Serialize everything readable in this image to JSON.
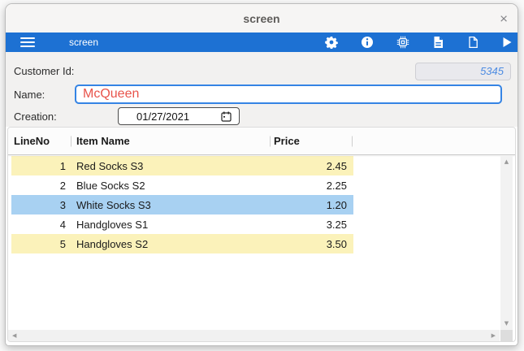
{
  "window": {
    "title": "screen",
    "close_glyph": "×"
  },
  "toolbar": {
    "app_label": "screen",
    "accent_color": "#1d71d3"
  },
  "form": {
    "customer_id": {
      "label": "Customer Id:",
      "value": "5345"
    },
    "name": {
      "label": "Name:",
      "value": "McQueen"
    },
    "creation": {
      "label": "Creation:",
      "value": "01/27/2021"
    }
  },
  "table": {
    "columns": {
      "line_no": "LineNo",
      "item_name": "Item Name",
      "price": "Price"
    },
    "rows": [
      {
        "line_no": "1",
        "item_name": "Red Socks S3",
        "price": "2.45",
        "highlight": "yellow"
      },
      {
        "line_no": "2",
        "item_name": "Blue Socks S2",
        "price": "2.25",
        "highlight": "none"
      },
      {
        "line_no": "3",
        "item_name": "White Socks S3",
        "price": "1.20",
        "highlight": "selected"
      },
      {
        "line_no": "4",
        "item_name": "Handgloves S1",
        "price": "3.25",
        "highlight": "none"
      },
      {
        "line_no": "5",
        "item_name": "Handgloves S2",
        "price": "3.50",
        "highlight": "yellow"
      }
    ],
    "colors": {
      "stripe_yellow": "#fbf2ba",
      "selected_blue": "#a8d1f2"
    }
  },
  "scrollbar": {
    "up": "▲",
    "down": "▼",
    "left": "◀",
    "right": "▶"
  }
}
